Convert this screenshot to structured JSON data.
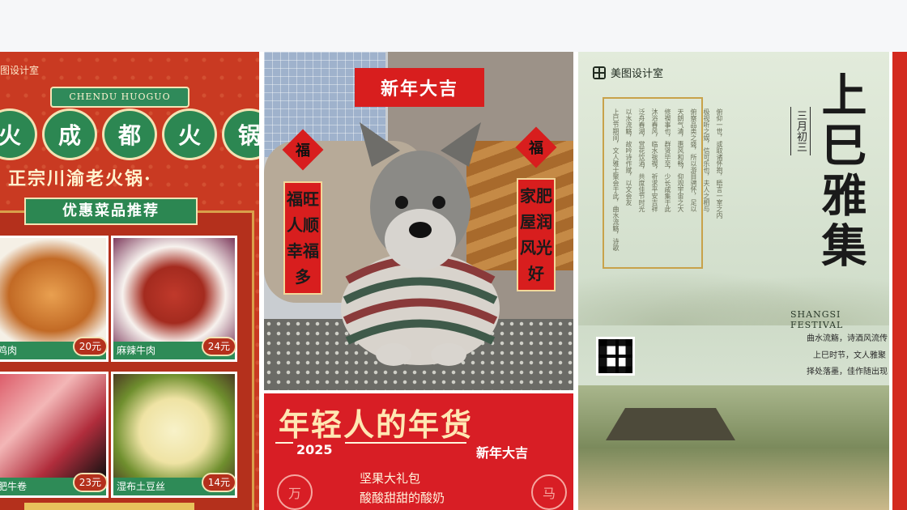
{
  "hotpot": {
    "brand": "图设计室",
    "ribbon": "CHENDU HUOGUO",
    "title_chars": [
      "火",
      "成",
      "都",
      "火",
      "锅"
    ],
    "subtitle": "正宗川渝老火锅·",
    "promo": "优惠菜品推荐",
    "dishes": [
      {
        "name": "椒鸡肉",
        "price": "20元"
      },
      {
        "name": "麻辣牛肉",
        "price": "24元"
      },
      {
        "name": "牌肥牛卷",
        "price": "23元"
      },
      {
        "name": "湿布土豆丝",
        "price": "14元"
      }
    ]
  },
  "dog_card": {
    "title": "新年大吉",
    "fu": "福",
    "left_couplet": "福旺人顺幸福多",
    "right_couplet": "家肥屋润风光好"
  },
  "goods_card": {
    "title": "年轻人的年货",
    "year": "2025",
    "greeting": "新年大吉",
    "items": [
      "坚果大礼包",
      "酸酸甜甜的酸奶"
    ],
    "stamp_left": "万",
    "stamp_right": "马"
  },
  "shangsi": {
    "logo": "美图设计室",
    "title": "上巳雅集",
    "date": "三月初三",
    "festival": "SHANGSI FESTIVAL",
    "lines": [
      "曲水流觞，诗酒风流传",
      "上巳时节，文人雅聚",
      "择处落墨，佳作随出现"
    ],
    "columns": [
      "上巳节期间，文人雅士聚会于此，曲水流觞，诗歌",
      "以水流觞，故吟诗作赋，以文会友",
      "泛舟春湖，赏花饮酒，共度佳节时光",
      "沐浴春风，临水祓禊，祈求平安吉祥",
      "修禊事也，群贤毕至，少长咸集于此",
      "天朗气清，惠风和畅，仰观宇宙之大",
      "俯察品类之盛，所以游目骋怀，足以",
      "极视听之娱，信可乐也，夫人之相与",
      "俯仰一世，或取诸怀抱，晤言一室之内"
    ]
  }
}
